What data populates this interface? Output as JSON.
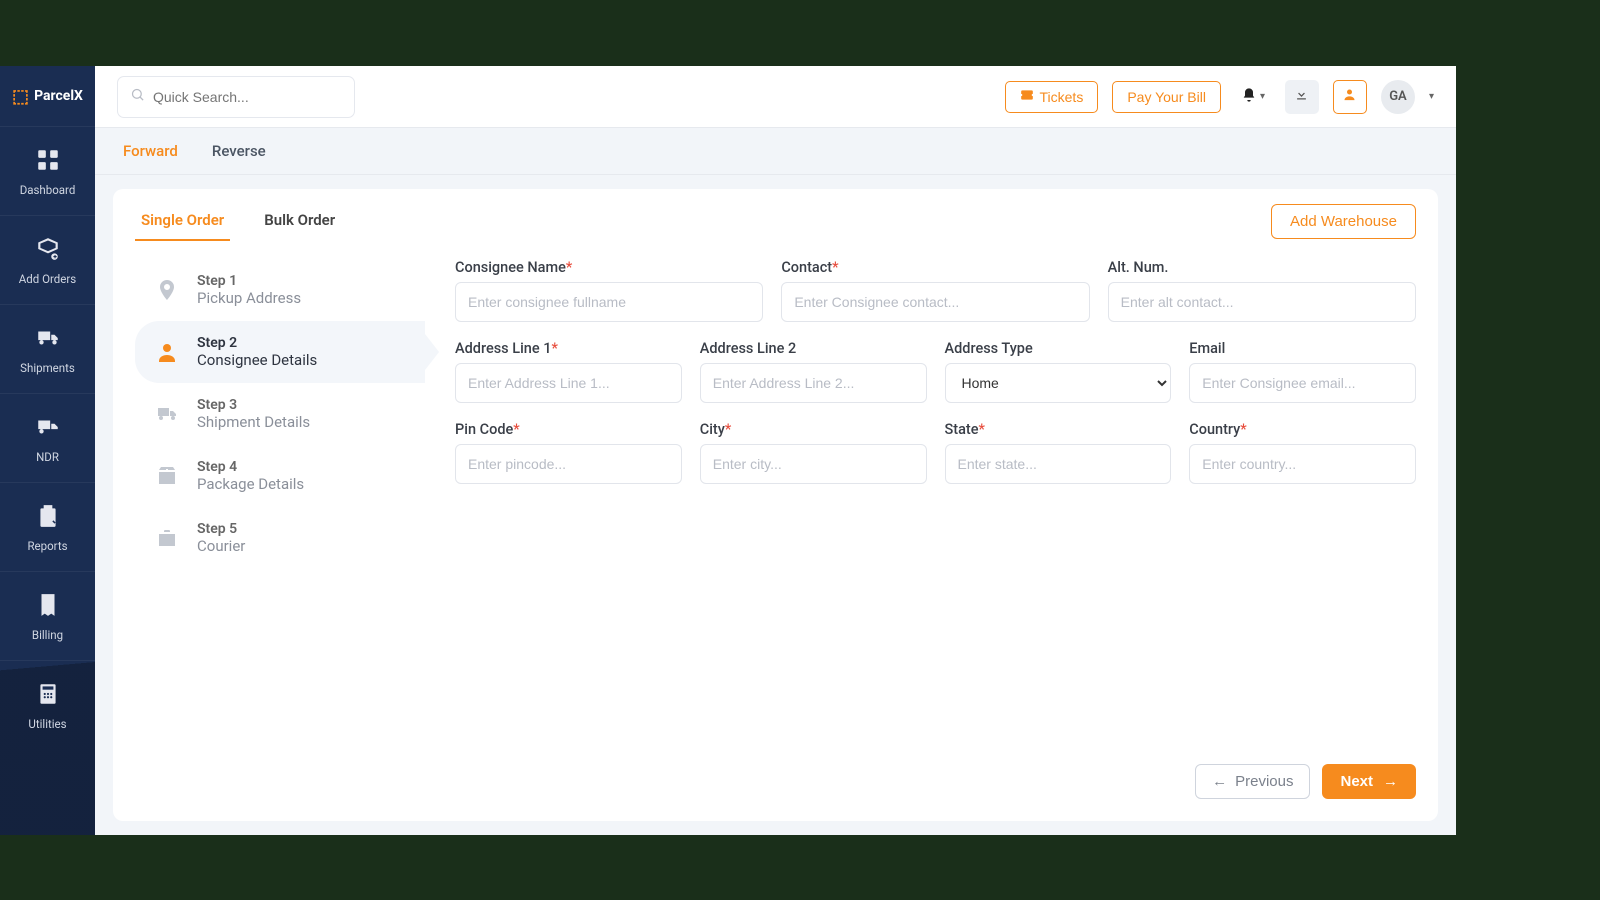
{
  "brand": "ParcelX",
  "topbar": {
    "search_placeholder": "Quick Search...",
    "tickets": "Tickets",
    "pay_bill": "Pay Your Bill",
    "avatar_initials": "GA"
  },
  "sidebar": {
    "items": [
      {
        "label": "Dashboard"
      },
      {
        "label": "Add Orders"
      },
      {
        "label": "Shipments"
      },
      {
        "label": "NDR"
      },
      {
        "label": "Reports"
      },
      {
        "label": "Billing"
      },
      {
        "label": "Utilities"
      }
    ]
  },
  "subtabs": {
    "forward": "Forward",
    "reverse": "Reverse"
  },
  "order_tabs": {
    "single": "Single Order",
    "bulk": "Bulk Order"
  },
  "add_warehouse": "Add Warehouse",
  "steps": [
    {
      "num": "Step 1",
      "title": "Pickup Address"
    },
    {
      "num": "Step 2",
      "title": "Consignee Details"
    },
    {
      "num": "Step 3",
      "title": "Shipment Details"
    },
    {
      "num": "Step 4",
      "title": "Package Details"
    },
    {
      "num": "Step 5",
      "title": "Courier"
    }
  ],
  "form": {
    "consignee_name": {
      "label": "Consignee Name",
      "placeholder": "Enter consignee fullname"
    },
    "contact": {
      "label": "Contact",
      "placeholder": "Enter Consignee contact..."
    },
    "alt_num": {
      "label": "Alt. Num.",
      "placeholder": "Enter alt contact..."
    },
    "address1": {
      "label": "Address Line 1",
      "placeholder": "Enter Address Line 1..."
    },
    "address2": {
      "label": "Address Line 2",
      "placeholder": "Enter Address Line 2..."
    },
    "address_type": {
      "label": "Address Type",
      "value": "Home"
    },
    "email": {
      "label": "Email",
      "placeholder": "Enter Consignee email..."
    },
    "pincode": {
      "label": "Pin Code",
      "placeholder": "Enter pincode..."
    },
    "city": {
      "label": "City",
      "placeholder": "Enter city..."
    },
    "state": {
      "label": "State",
      "placeholder": "Enter state..."
    },
    "country": {
      "label": "Country",
      "placeholder": "Enter country..."
    }
  },
  "buttons": {
    "previous": "Previous",
    "next": "Next"
  }
}
